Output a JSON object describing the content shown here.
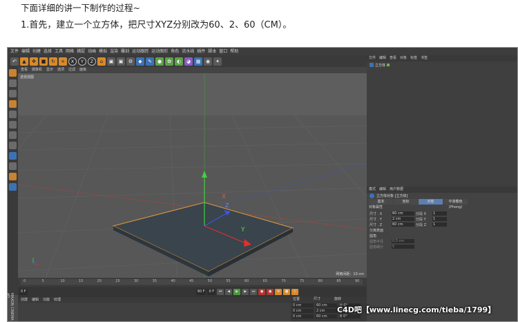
{
  "article": {
    "line1": "下面详细的讲一下制作的过程~",
    "line2": "1.首先，建立一个立方体，把尺寸XYZ分别改为60、2、60（CM）。"
  },
  "c4d": {
    "menus": [
      "文件",
      "编辑",
      "创建",
      "选择",
      "工具",
      "网格",
      "捕捉",
      "动画",
      "模拟",
      "渲染",
      "雕刻",
      "运动跟踪",
      "运动图形",
      "角色",
      "流水线",
      "插件",
      "脚本",
      "窗口",
      "帮助"
    ],
    "toolbar_axes": [
      "X",
      "Y",
      "Z"
    ],
    "viewport_menus": [
      "查看",
      "摄像机",
      "显示",
      "选项",
      "过滤",
      "面板"
    ],
    "viewport_name": "透视视图",
    "grid_spacing": "网格间距：10 cm",
    "timeline_ticks": [
      "0",
      "5",
      "10",
      "15",
      "20",
      "25",
      "30",
      "35",
      "40",
      "45",
      "50",
      "55",
      "60",
      "65",
      "70",
      "75",
      "80",
      "85",
      "90"
    ],
    "frame_start": "0 F",
    "frame_end": "90 F",
    "frame_current": "0 F",
    "bottom_tabs": [
      "创建",
      "编辑",
      "功能",
      "纹理"
    ],
    "coord_headers": [
      "位置",
      "尺寸",
      "旋转"
    ],
    "coord_rows": [
      [
        "0 cm",
        "60 cm",
        "H 0°"
      ],
      [
        "0 cm",
        "2 cm",
        "P 0°"
      ],
      [
        "0 cm",
        "60 cm",
        "B 0°"
      ]
    ],
    "object_tabs": [
      "文件",
      "编辑",
      "查看",
      "对象",
      "标签",
      "书签"
    ],
    "object_name": "立方体",
    "attr_tabs": [
      "模式",
      "编辑",
      "用户数据"
    ],
    "attr_title": "立方体对象 [立方体]",
    "attr_subtabs": [
      "基本",
      "坐标",
      "对象",
      "平滑着色(Phong)"
    ],
    "attr_section": "对象属性",
    "attr_rows": [
      {
        "label": "尺寸 . X",
        "value": "60 cm",
        "label2": "分段 X",
        "value2": "1"
      },
      {
        "label": "尺寸 . Y",
        "value": "2 cm",
        "label2": "分段 Y",
        "value2": "1"
      },
      {
        "label": "尺寸 . Z",
        "value": "60 cm",
        "label2": "分段 Z",
        "value2": "1"
      }
    ],
    "attr_extra": [
      {
        "label": "分离表面",
        "value": ""
      },
      {
        "label": "圆角",
        "value": ""
      },
      {
        "label": "圆角半径",
        "value": "0.5 cm"
      },
      {
        "label": "圆角细分",
        "value": "5"
      }
    ],
    "side_label": "MAXON CINEMA 4D"
  },
  "watermark": "C4D吧【www.linecg.com/tieba/1799】"
}
